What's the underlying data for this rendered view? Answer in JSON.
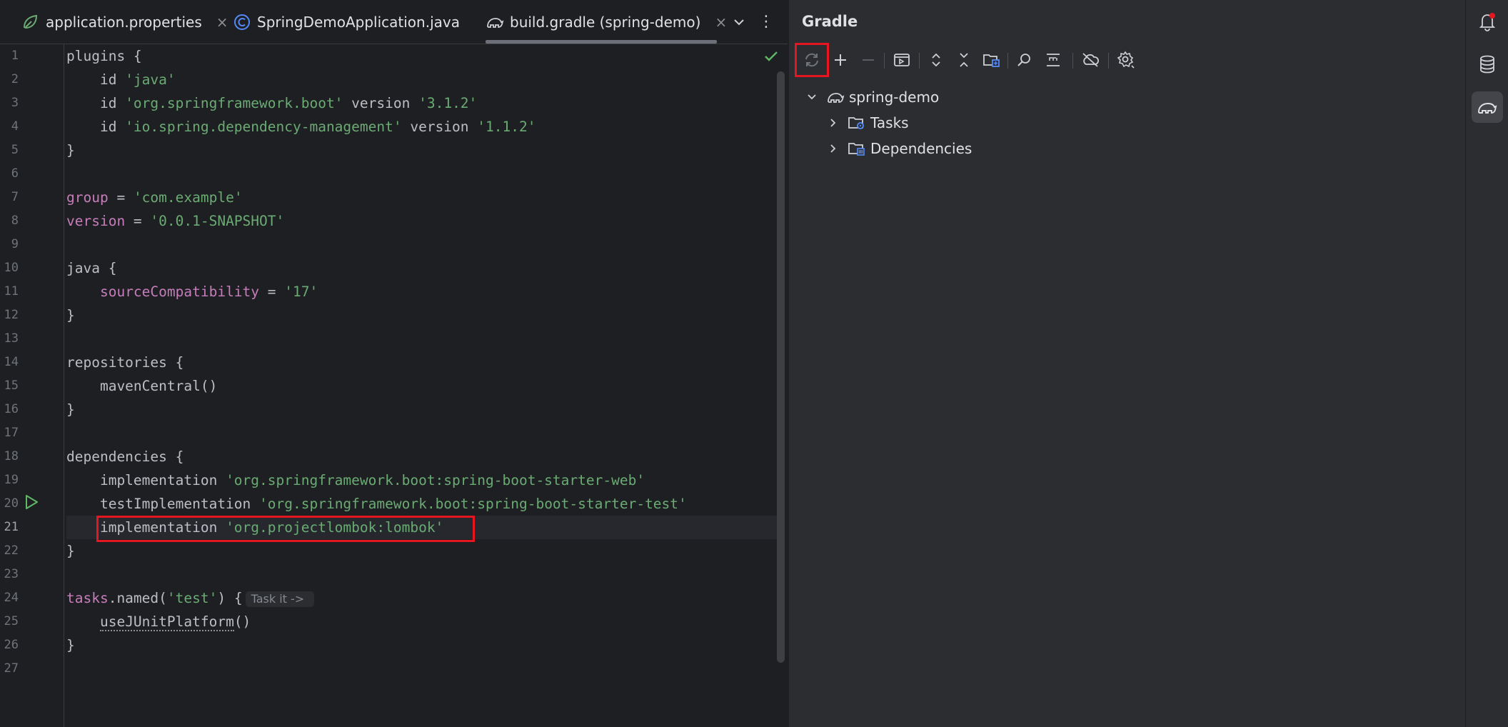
{
  "tabs": [
    {
      "label": "application.properties",
      "icon": "spring-leaf-icon",
      "closable": true
    },
    {
      "label": "SpringDemoApplication.java",
      "icon": "java-class-icon",
      "closable": false
    },
    {
      "label": "build.gradle (spring-demo)",
      "icon": "gradle-elephant-icon",
      "closable": true,
      "active": true
    }
  ],
  "tab_tools": {
    "dropdown": "⌄",
    "more": "⋮",
    "close_symbol": "×"
  },
  "editor": {
    "line_numbers": [
      "1",
      "2",
      "3",
      "4",
      "5",
      "6",
      "7",
      "8",
      "9",
      "10",
      "11",
      "12",
      "13",
      "14",
      "15",
      "16",
      "17",
      "18",
      "19",
      "20",
      "21",
      "22",
      "23",
      "24",
      "25",
      "26",
      "27"
    ],
    "current_line": 21,
    "lines": {
      "l1_kw": "plugins {",
      "l2_a": "    id ",
      "l2_s": "'java'",
      "l3_a": "    id ",
      "l3_s": "'org.springframework.boot'",
      "l3_b": " version ",
      "l3_v": "'3.1.2'",
      "l4_a": "    id ",
      "l4_s": "'io.spring.dependency-management'",
      "l4_b": " version ",
      "l4_v": "'1.1.2'",
      "l5": "}",
      "l7_p": "group",
      "l7_eq": " = ",
      "l7_s": "'com.example'",
      "l8_p": "version",
      "l8_eq": " = ",
      "l8_s": "'0.0.1-SNAPSHOT'",
      "l10": "java {",
      "l11_i": "    ",
      "l11_p": "sourceCompatibility",
      "l11_eq": " = ",
      "l11_s": "'17'",
      "l12": "}",
      "l14": "repositories {",
      "l15": "    mavenCentral()",
      "l16": "}",
      "l18": "dependencies {",
      "l19_a": "    implementation ",
      "l19_s": "'org.springframework.boot:spring-boot-starter-web'",
      "l20_a": "    testImplementation ",
      "l20_s": "'org.springframework.boot:spring-boot-starter-test'",
      "l21_a": "    implementation ",
      "l21_s": "'org.projectlombok:lombok'",
      "l22": "}",
      "l24_p": "tasks",
      "l24_a": ".named(",
      "l24_s": "'test'",
      "l24_b": ") {",
      "l24_hint": "Task it ->",
      "l25_i": "    ",
      "l25_m": "useJUnitPlatform",
      "l25_b": "()",
      "l26": "}"
    }
  },
  "gradle": {
    "title": "Gradle",
    "toolbar": [
      "reload-all-gradle-projects",
      "add",
      "remove",
      "execute-task",
      "expand-all",
      "collapse-all",
      "link-project",
      "analyze-dependencies",
      "show-options",
      "toggle-offline-mode",
      "gradle-settings"
    ],
    "tree": {
      "root": "spring-demo",
      "children": [
        "Tasks",
        "Dependencies"
      ]
    }
  },
  "colors": {
    "accent_red": "#e5161f",
    "string_green": "#6aab73",
    "property_purple": "#c77dbb",
    "run_green": "#5fb865"
  }
}
